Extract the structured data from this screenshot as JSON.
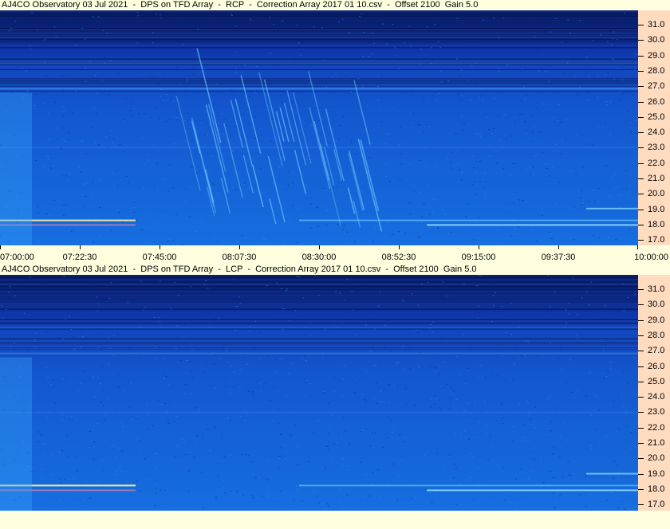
{
  "panels": [
    {
      "title": "AJ4CO Observatory 03 Jul 2021  -  DPS on TFD Array  -  RCP  -  Correction Array 2017 01 10.csv  -  Offset 2100  Gain 5.0",
      "polarization": "RCP",
      "freq_ticks": [
        "31.0",
        "30.0",
        "29.0",
        "28.0",
        "27.0",
        "26.0",
        "25.0",
        "24.0",
        "23.0",
        "22.0",
        "21.0",
        "20.0",
        "19.0",
        "18.0",
        "17.0"
      ],
      "time_ticks": [
        "07:00:00",
        "07:22:30",
        "07:45:00",
        "08:07:30",
        "08:30:00",
        "08:52:30",
        "09:15:00",
        "09:37:30",
        "10:00:00"
      ]
    },
    {
      "title": "AJ4CO Observatory 03 Jul 2021  -  DPS on TFD Array  -  LCP  -  Correction Array 2017 01 10.csv  -  Offset 2100  Gain 5.0",
      "polarization": "LCP",
      "freq_ticks": [
        "31.0",
        "30.0",
        "29.0",
        "28.0",
        "27.0",
        "26.0",
        "25.0",
        "24.0",
        "23.0",
        "22.0",
        "21.0",
        "20.0",
        "19.0",
        "18.0",
        "17.0"
      ],
      "time_ticks": []
    }
  ],
  "colors": {
    "background": "#ffffe0",
    "freq_axis_bg": "#ffdcc0",
    "spectrum_dark": "#07195e",
    "spectrum_light": "#166ee0"
  }
}
